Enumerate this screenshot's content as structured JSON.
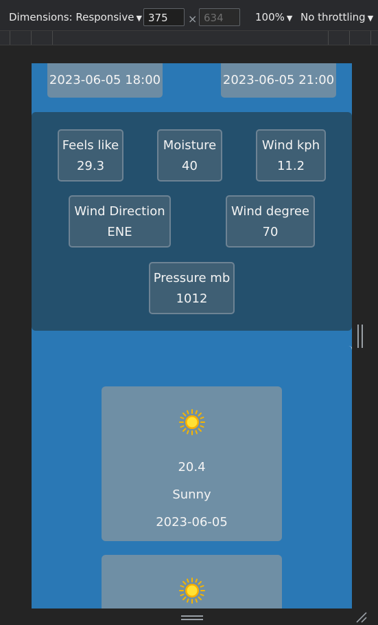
{
  "devtools": {
    "dimensions_label": "Dimensions: Responsive",
    "width": "375",
    "height": "634",
    "times": "×",
    "zoom": "100%",
    "throttling": "No throttling"
  },
  "hourly": [
    {
      "time": "2023-06-05 18:00"
    },
    {
      "time": "2023-06-05 21:00"
    }
  ],
  "details": [
    {
      "label": "Feels like",
      "value": "29.3"
    },
    {
      "label": "Moisture",
      "value": "40"
    },
    {
      "label": "Wind kph",
      "value": "11.2"
    },
    {
      "label": "Wind Direction",
      "value": "ENE"
    },
    {
      "label": "Wind degree",
      "value": "70"
    },
    {
      "label": "Pressure mb",
      "value": "1012"
    }
  ],
  "forecast": [
    {
      "temp": "20.4",
      "condition": "Sunny",
      "date": "2023-06-05",
      "icon": "sun-icon"
    },
    {
      "icon": "sun-icon"
    }
  ],
  "colors": {
    "page_bg": "#2a78b5",
    "details_bg": "#24506d",
    "card_bg": "#6f8fa5",
    "sun": "#ffd200"
  }
}
